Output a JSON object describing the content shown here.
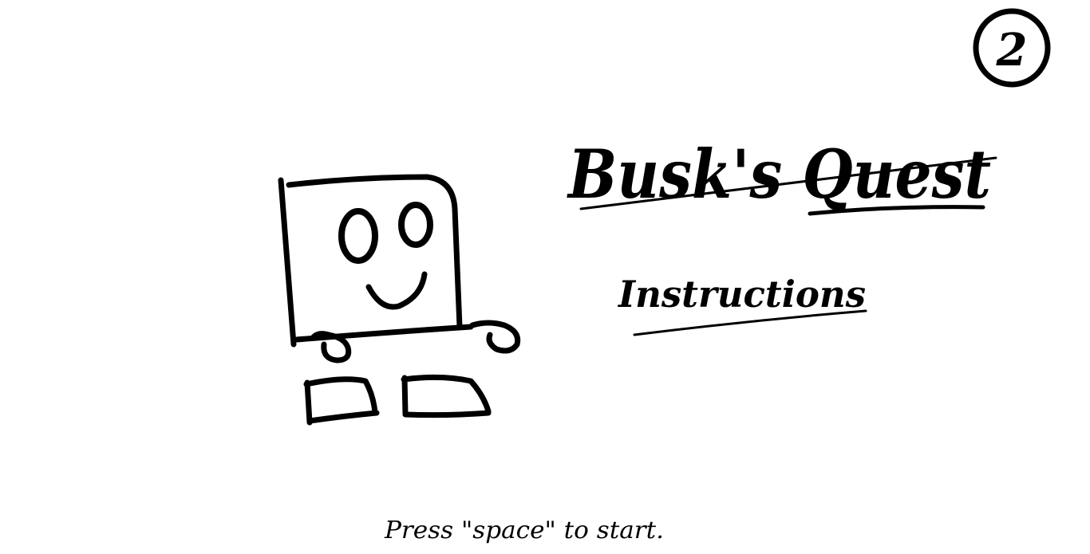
{
  "game": {
    "level_number": "2",
    "title": "Busk's Quest",
    "instructions_label": "Instructions",
    "start_prompt": "Press \"space\" to start."
  },
  "colors": {
    "background": "#ffffff",
    "ink": "#000000"
  }
}
